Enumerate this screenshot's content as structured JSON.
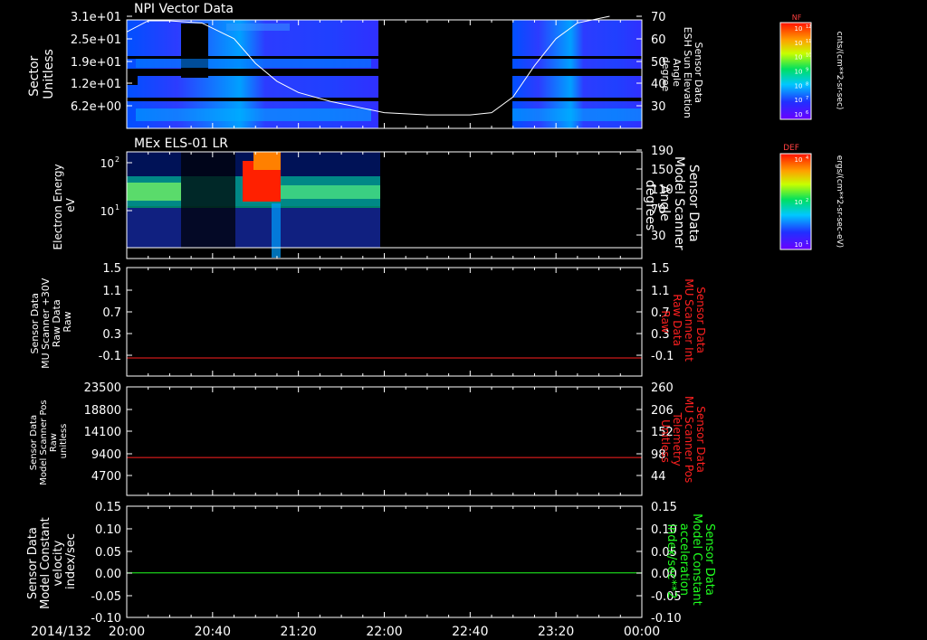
{
  "date_label": "2014/132",
  "time_ticks": [
    "20:00",
    "20:40",
    "21:20",
    "22:00",
    "22:40",
    "23:20",
    "00:00"
  ],
  "panels": [
    {
      "id": "npi",
      "title": "NPI Vector Data",
      "left_label": [
        "Sector",
        "Unitless"
      ],
      "left_ticks": [
        "3.1e+01",
        "2.5e+01",
        "1.9e+01",
        "1.2e+01",
        "6.2e+00"
      ],
      "right_ticks": [
        "70",
        "60",
        "50",
        "40",
        "30"
      ],
      "right_label": [
        "Sensor Data",
        "ESH Sun Elevation",
        "Angle",
        "degree"
      ],
      "right_label_color": "#ffffff"
    },
    {
      "id": "els",
      "title": "MEx ELS-01 LR",
      "left_label": [
        "Electron Energy",
        "eV"
      ],
      "left_ticks": [
        "10",
        "10"
      ],
      "left_tick_exps": [
        "2",
        "1"
      ],
      "right_ticks": [
        "190",
        "150",
        "110",
        "70",
        "30"
      ],
      "right_label": [
        "Sensor Data",
        "Model Scanner",
        "Angle",
        "degrees"
      ],
      "right_label_color": "#ffffff"
    },
    {
      "id": "mu30v",
      "left_label": [
        "Sensor Data",
        "MU Scanner +30V",
        "Raw Data",
        "Raw"
      ],
      "left_ticks": [
        "1.5",
        "1.1",
        "0.7",
        "0.3",
        "-0.1"
      ],
      "right_ticks": [
        "1.5",
        "1.1",
        "0.7",
        "0.3",
        "-0.1"
      ],
      "right_label": [
        "Sensor Data",
        "MU Scanner Int",
        "Raw Data",
        "Raw"
      ],
      "right_label_color": "#ff2020"
    },
    {
      "id": "scanpos",
      "left_label": [
        "Sensor Data",
        "Model Scanner Pos",
        "Raw",
        "unitless"
      ],
      "left_ticks": [
        "23500",
        "18800",
        "14100",
        "9400",
        "4700"
      ],
      "right_ticks": [
        "260",
        "206",
        "152",
        "98",
        "44"
      ],
      "right_label": [
        "Sensor Data",
        "MU Scanner Pos",
        "Telemetry",
        "Unitless"
      ],
      "right_label_color": "#ff2020"
    },
    {
      "id": "const",
      "left_label": [
        "Sensor Data",
        "Model Constant",
        "velocity",
        "index/sec"
      ],
      "left_ticks": [
        "0.15",
        "0.10",
        "0.05",
        "0.00",
        "-0.05",
        "-0.10"
      ],
      "right_ticks": [
        "0.15",
        "0.10",
        "0.05",
        "0.00",
        "-0.05",
        "-0.10"
      ],
      "right_label": [
        "Sensor Data",
        "Model Constant",
        "acceleration",
        "index/sec**2"
      ],
      "right_label_color": "#20ff20"
    }
  ],
  "colorbars": [
    {
      "id": "nf",
      "title": "NF",
      "ticks": [
        "10",
        "10",
        "10",
        "10",
        "10",
        "10",
        "10"
      ],
      "tick_exps": [
        "12",
        "11",
        "10",
        "9",
        "8",
        "7",
        "6"
      ],
      "unit": "cnts/(cm**2-sr-sec)"
    },
    {
      "id": "def",
      "title": "DEF",
      "ticks": [
        "10",
        "10",
        "10"
      ],
      "tick_exps": [
        "4",
        "2",
        "1"
      ],
      "unit": "ergs/(cm**2-sr-sec-eV)"
    }
  ],
  "chart_data": [
    {
      "type": "heatmap",
      "title": "NPI Vector Data",
      "ylabel": "Sector Unitless",
      "ytick_labels": [
        "3.1e+01",
        "2.5e+01",
        "1.9e+01",
        "1.2e+01",
        "6.2e+00"
      ],
      "data_gap": [
        "22:00",
        "22:48"
      ],
      "overlay_line": {
        "name": "ESH Sun Elevation Angle",
        "y_axis": "right",
        "ylim": [
          20,
          70
        ],
        "x": [
          "20:00",
          "20:10",
          "20:20",
          "20:35",
          "20:50",
          "21:00",
          "21:10",
          "21:20",
          "21:35",
          "21:50",
          "22:00",
          "22:20",
          "22:40",
          "22:50",
          "23:00",
          "23:10",
          "23:20",
          "23:30",
          "23:45"
        ],
        "y": [
          63,
          68,
          68,
          67,
          60,
          49,
          41,
          36,
          32,
          29,
          27,
          26,
          26,
          27,
          34,
          48,
          60,
          67,
          70
        ]
      }
    },
    {
      "type": "heatmap",
      "title": "MEx ELS-01 LR",
      "ylabel": "Electron Energy eV",
      "yscale": "log",
      "data_end": "22:00",
      "overlay_line": {
        "name": "Model Scanner Angle",
        "y_axis": "right",
        "ylim": [
          10,
          190
        ],
        "x": [
          "20:00",
          "00:00"
        ],
        "y": [
          10,
          10
        ]
      }
    },
    {
      "type": "line",
      "ylabel": "MU Scanner +30V Raw Data",
      "ylim": [
        -0.3,
        1.5
      ],
      "series": [
        {
          "name": "MU Scanner Int Raw Data",
          "color": "#ff2020",
          "x": [
            "20:00",
            "00:00"
          ],
          "y": [
            0.0,
            0.0
          ]
        }
      ]
    },
    {
      "type": "line",
      "ylabel": "Model Scanner Pos Raw",
      "ylim": [
        0,
        23500
      ],
      "series": [
        {
          "name": "MU Scanner Pos Telemetry",
          "color": "#ff2020",
          "x": [
            "20:00",
            "00:00"
          ],
          "y": [
            8200,
            8200
          ]
        }
      ]
    },
    {
      "type": "line",
      "ylabel": "Model Constant velocity",
      "ylim": [
        -0.1,
        0.15
      ],
      "series": [
        {
          "name": "Model Constant acceleration",
          "color": "#20ff20",
          "x": [
            "20:00",
            "00:00"
          ],
          "y": [
            0.0,
            0.0
          ]
        }
      ]
    }
  ]
}
